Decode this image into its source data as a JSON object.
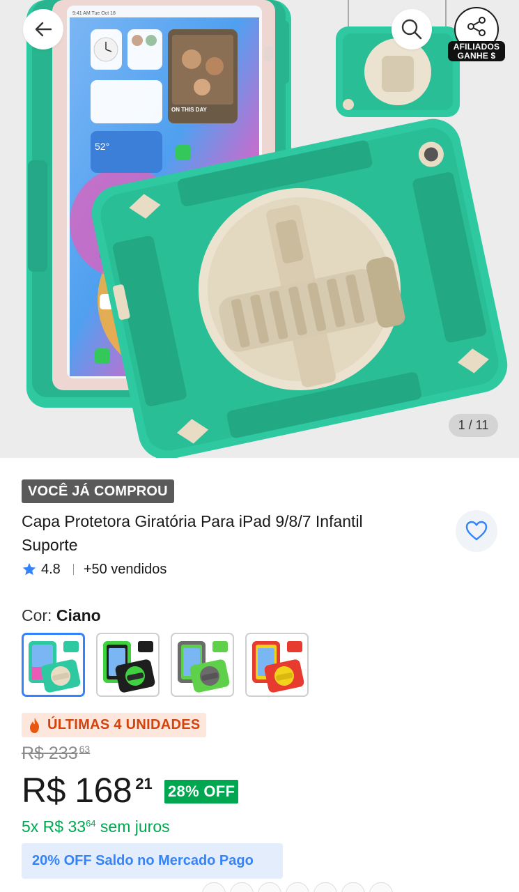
{
  "gallery": {
    "pager_text": "1 / 11",
    "affiliate_badge": [
      "AFILIADOS",
      "GANHE $"
    ],
    "icons": {
      "back": "arrow-left-icon",
      "search": "search-icon",
      "share": "share-icon"
    },
    "screen_status_text": "9:41 AM  Tue Oct 18",
    "widget_weather_temp": "52°",
    "widget_photo_caption": "ON THIS DAY"
  },
  "product": {
    "bought_badge": "VOCÊ JÁ COMPROU",
    "title": "Capa Protetora Giratória Para iPad 9/8/7 Infantil Suporte",
    "rating": "4.8",
    "sold": "+50 vendidos",
    "favorite_icon": "heart-icon"
  },
  "color": {
    "label": "Cor:",
    "selected": "Ciano",
    "options": [
      {
        "name": "Ciano",
        "body": "#2ec9a0",
        "accent": "#e8dcc4"
      },
      {
        "name": "Preto/Verde",
        "body": "#1e1e1e",
        "accent": "#3fd13f"
      },
      {
        "name": "Verde/Cinza",
        "body": "#5fd04a",
        "accent": "#6b6b6b"
      },
      {
        "name": "Vermelho/Amarelo",
        "body": "#e63b2e",
        "accent": "#f2d21b"
      }
    ]
  },
  "stock": {
    "text": "ÚLTIMAS 4 UNIDADES",
    "icon": "flame-icon"
  },
  "pricing": {
    "old_currency_int": "R$ 233",
    "old_cents": "63",
    "currency_int": "R$ 168",
    "cents": "21",
    "discount": "28% OFF",
    "installments_prefix": "5x R$ 33",
    "installments_cents": "64",
    "installments_suffix": " sem juros",
    "promo": "20% OFF Saldo no Mercado Pago"
  },
  "colors": {
    "accent_blue": "#3483fa",
    "green": "#00a650",
    "case_teal": "#2ec9a0",
    "urgency": "#d4420d"
  }
}
